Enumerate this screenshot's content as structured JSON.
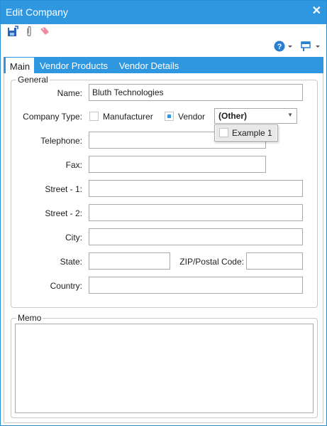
{
  "window": {
    "title": "Edit Company",
    "close_glyph": "✕"
  },
  "toolbar": {
    "icons": [
      "save-close-icon",
      "attachment-icon",
      "tag-icon"
    ],
    "help_icon": "help-icon",
    "layout_icon": "layout-icon"
  },
  "tabs": [
    {
      "label": "Main",
      "active": true
    },
    {
      "label": "Vendor Products",
      "active": false
    },
    {
      "label": "Vendor Details",
      "active": false
    }
  ],
  "general": {
    "legend": "General",
    "name_label": "Name:",
    "name_value": "Bluth Technologies",
    "company_type_label": "Company Type:",
    "manufacturer_label": "Manufacturer",
    "manufacturer_checked": false,
    "vendor_label": "Vendor",
    "vendor_checked": true,
    "vendor_type_value": "(Other)",
    "dropdown_items": [
      {
        "label": "Example 1",
        "checked": false
      }
    ],
    "telephone_label": "Telephone:",
    "fax_label": "Fax:",
    "street1_label": "Street - 1:",
    "street2_label": "Street - 2:",
    "city_label": "City:",
    "state_label": "State:",
    "zip_label": "ZIP/Postal Code:",
    "country_label": "Country:"
  },
  "memo": {
    "legend": "Memo"
  },
  "colors": {
    "accent": "#2e97df"
  }
}
